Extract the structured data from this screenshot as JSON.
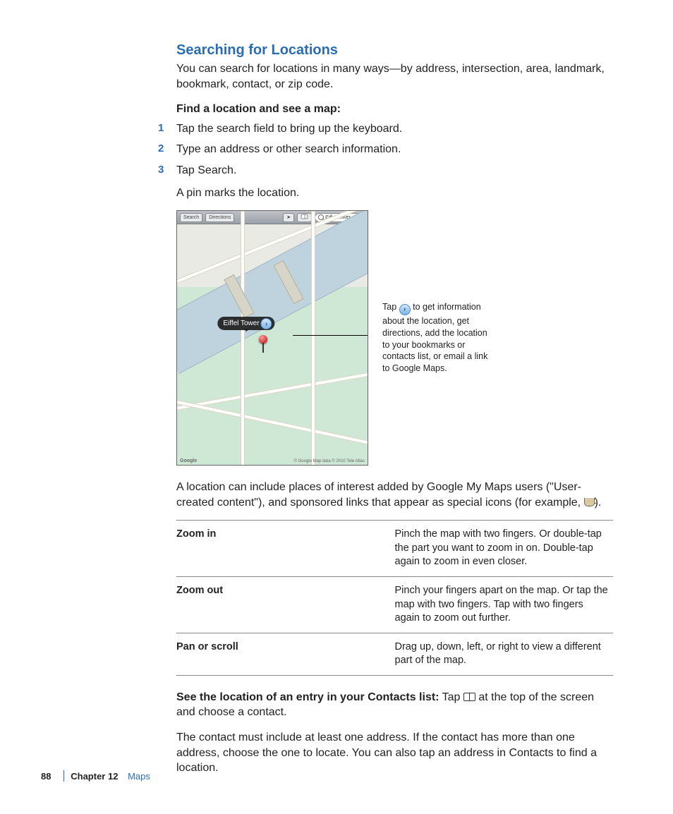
{
  "heading": "Searching for Locations",
  "intro": "You can search for locations in many ways—by address, intersection, area, landmark, bookmark, contact, or zip code.",
  "find_heading": "Find a location and see a map:",
  "steps": [
    "Tap the search field to bring up the keyboard.",
    "Type an address or other search information.",
    "Tap Search."
  ],
  "pin_sentence": "A pin marks the location.",
  "map": {
    "toolbar_search_btn": "Search",
    "toolbar_directions_btn": "Directions",
    "search_value": "Eiffel Tower",
    "pin_label": "Eiffel Tower",
    "credit": "© Google  Map data © 2010 Tele Atlas",
    "logo": "Google"
  },
  "annotation_pre": "Tap ",
  "annotation_post": " to get information about the location, get directions, add the location to your bookmarks or contacts list, or email a link to Google Maps.",
  "after_figure_para_pre": "A location can include places of interest added by Google My Maps users (\"User-created content\"), and sponsored links that appear as special icons (for example, ",
  "after_figure_para_post": ").",
  "gestures": [
    {
      "k": "Zoom in",
      "v": "Pinch the map with two fingers. Or double-tap the part you want to zoom in on. Double-tap again to zoom in even closer."
    },
    {
      "k": "Zoom out",
      "v": "Pinch your fingers apart on the map. Or tap the map with two fingers. Tap with two fingers again to zoom out further."
    },
    {
      "k": "Pan or scroll",
      "v": "Drag up, down, left, or right to view a different part of the map."
    }
  ],
  "contacts_lead": "See the location of an entry in your Contacts list:",
  "contacts_tail_pre": "  Tap ",
  "contacts_tail_post": " at the top of the screen and choose a contact.",
  "contacts_para2": "The contact must include at least one address. If the contact has more than one address, choose the one to locate. You can also tap an address in Contacts to find a location.",
  "footer": {
    "page": "88",
    "chapter_label": "Chapter 12",
    "chapter_name": "Maps"
  }
}
